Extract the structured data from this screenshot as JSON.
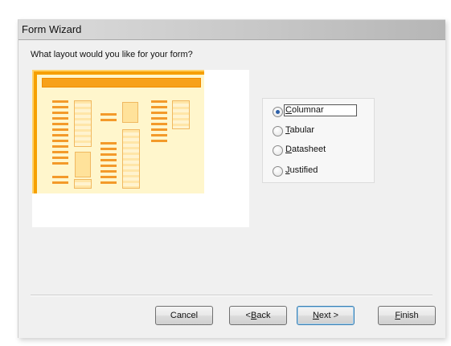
{
  "window": {
    "title": "Form Wizard"
  },
  "question": "What layout would you like for your form?",
  "layout_options": [
    {
      "mnemonic": "C",
      "rest": "olumnar",
      "selected": true
    },
    {
      "mnemonic": "T",
      "rest": "abular",
      "selected": false
    },
    {
      "mnemonic": "D",
      "rest": "atasheet",
      "selected": false
    },
    {
      "mnemonic": "J",
      "rest": "ustified",
      "selected": false
    }
  ],
  "buttons": {
    "cancel": {
      "pre": "Cancel",
      "mnemonic": "",
      "post": ""
    },
    "back": {
      "pre": "< ",
      "mnemonic": "B",
      "post": "ack"
    },
    "next": {
      "pre": "",
      "mnemonic": "N",
      "post": "ext >"
    },
    "finish": {
      "pre": "",
      "mnemonic": "F",
      "post": "inish"
    }
  },
  "colors": {
    "preview_accent": "#f6a000",
    "preview_fill": "#fff6cc",
    "selected_radio": "#2c5fa8",
    "default_button_border": "#3c7fb1"
  },
  "icons": {
    "layout_preview": "columnar-layout-preview-graphic"
  }
}
